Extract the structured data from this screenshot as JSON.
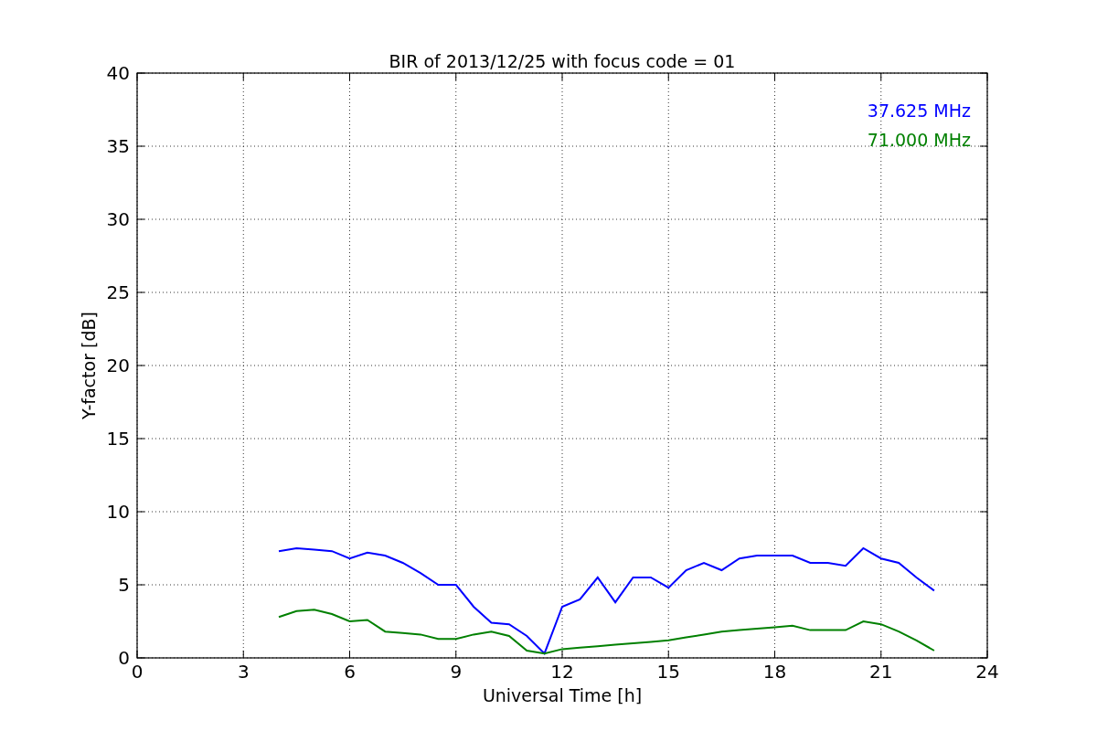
{
  "chart_data": {
    "type": "line",
    "title": "BIR of 2013/12/25 with focus code = 01",
    "xlabel": "Universal Time [h]",
    "ylabel": "Y-factor [dB]",
    "x": [
      4.0,
      4.5,
      5.0,
      5.5,
      6.0,
      6.5,
      7.0,
      7.5,
      8.0,
      8.5,
      9.0,
      9.5,
      10.0,
      10.5,
      11.0,
      11.5,
      12.0,
      12.5,
      13.0,
      13.5,
      14.0,
      14.5,
      15.0,
      15.5,
      16.0,
      16.5,
      17.0,
      17.5,
      18.0,
      18.5,
      19.0,
      19.5,
      20.0,
      20.5,
      21.0,
      21.5,
      22.0,
      22.5
    ],
    "series": [
      {
        "name": "37.625 MHz",
        "color": "#0000ff",
        "values": [
          7.3,
          7.5,
          7.4,
          7.3,
          6.8,
          7.2,
          7.0,
          6.5,
          5.8,
          5.0,
          5.0,
          3.5,
          2.4,
          2.3,
          1.5,
          0.3,
          3.5,
          4.0,
          5.5,
          3.8,
          5.5,
          5.5,
          4.8,
          6.0,
          6.5,
          6.0,
          6.8,
          7.0,
          7.0,
          7.0,
          6.5,
          6.5,
          6.3,
          7.5,
          6.8,
          6.5,
          5.5,
          4.6
        ]
      },
      {
        "name": "71.000 MHz",
        "color": "#008000",
        "values": [
          2.8,
          3.2,
          3.3,
          3.0,
          2.5,
          2.6,
          1.8,
          1.7,
          1.6,
          1.3,
          1.3,
          1.6,
          1.8,
          1.5,
          0.5,
          0.3,
          0.6,
          0.7,
          0.8,
          0.9,
          1.0,
          1.1,
          1.2,
          1.4,
          1.6,
          1.8,
          1.9,
          2.0,
          2.1,
          2.2,
          1.9,
          1.9,
          1.9,
          2.5,
          2.3,
          1.8,
          1.2,
          0.5
        ]
      }
    ],
    "grid": true,
    "xlim": [
      0,
      24
    ],
    "ylim": [
      0,
      40
    ],
    "xticks": [
      0,
      3,
      6,
      9,
      12,
      15,
      18,
      21,
      24
    ],
    "yticks": [
      0,
      5,
      10,
      15,
      20,
      25,
      30,
      35,
      40
    ]
  }
}
